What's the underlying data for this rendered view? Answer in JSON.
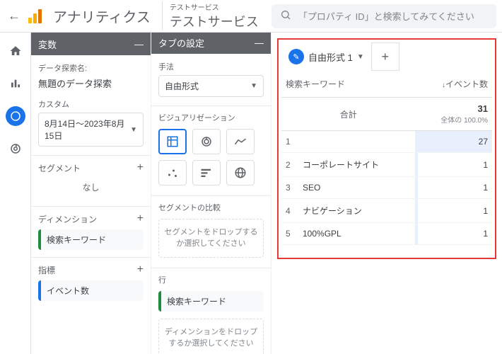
{
  "header": {
    "brand": "アナリティクス",
    "property_sub": "テストサービス",
    "property_main": "テストサービス",
    "search_placeholder": "「プロパティ ID」と検索してみてください"
  },
  "panel_vars": {
    "title": "変数",
    "explore_name_label": "データ探索名:",
    "explore_name_value": "無題のデータ探索",
    "custom_label": "カスタム",
    "date_range": "8月14日～2023年8月15日",
    "segments_label": "セグメント",
    "segments_none": "なし",
    "dimensions_label": "ディメンション",
    "dimension_chip": "検索キーワード",
    "metrics_label": "指標",
    "metric_chip": "イベント数"
  },
  "panel_tabs": {
    "title": "タブの設定",
    "technique_label": "手法",
    "technique_value": "自由形式",
    "viz_label": "ビジュアリゼーション",
    "segment_compare_label": "セグメントの比較",
    "segment_drop": "セグメントをドロップするか選択してください",
    "rows_label": "行",
    "rows_chip": "検索キーワード",
    "dimension_drop": "ディメンションをドロップするか選択してください"
  },
  "report": {
    "tab_name": "自由形式 1",
    "col_keyword": "検索キーワード",
    "col_events": "イベント数",
    "total_label": "合計",
    "total_value": "31",
    "total_subtext": "全体の 100.0%",
    "rows": [
      {
        "idx": "1",
        "keyword": "",
        "value": "27"
      },
      {
        "idx": "2",
        "keyword": "コーポレートサイト",
        "value": "1"
      },
      {
        "idx": "3",
        "keyword": "SEO",
        "value": "1"
      },
      {
        "idx": "4",
        "keyword": "ナビゲーション",
        "value": "1"
      },
      {
        "idx": "5",
        "keyword": "100%GPL",
        "value": "1"
      }
    ]
  }
}
